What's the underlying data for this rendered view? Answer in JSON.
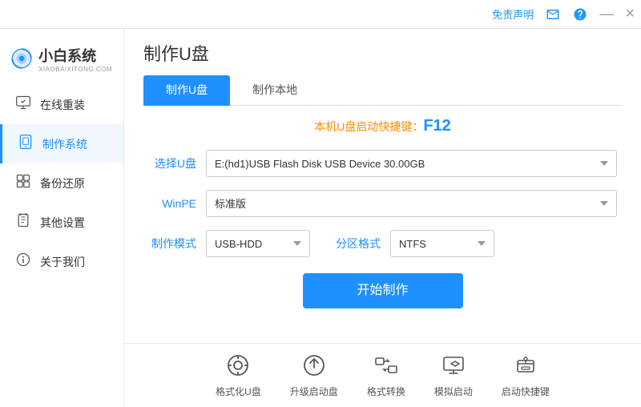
{
  "titlebar": {
    "free_declaration": "免责声明",
    "minimize": "—",
    "close": "×"
  },
  "logo": {
    "main_text": "小白系统",
    "sub_text": "XIAOBAIXITONG.COM"
  },
  "sidebar": {
    "items": [
      {
        "id": "online-reinstall",
        "label": "在线重装",
        "icon": "🖥"
      },
      {
        "id": "make-system",
        "label": "制作系统",
        "icon": "💾"
      },
      {
        "id": "backup-restore",
        "label": "备份还原",
        "icon": "🗂"
      },
      {
        "id": "other-settings",
        "label": "其他设置",
        "icon": "🔒"
      },
      {
        "id": "about-us",
        "label": "关于我们",
        "icon": "ℹ"
      }
    ],
    "active": "make-system"
  },
  "page": {
    "title": "制作U盘",
    "tabs": [
      {
        "id": "make-udisk",
        "label": "制作U盘",
        "active": true
      },
      {
        "id": "make-local",
        "label": "制作本地",
        "active": false
      }
    ]
  },
  "form": {
    "shortcut_prefix": "本机U盘启动快捷键：",
    "shortcut_key": "F12",
    "select_udisk_label": "选择U盘",
    "select_udisk_value": "E:(hd1)USB Flash Disk USB Device 30.00GB",
    "winpe_label": "WinPE",
    "winpe_value": "标准版",
    "make_mode_label": "制作模式",
    "make_mode_value": "USB-HDD",
    "partition_format_label": "分区格式",
    "partition_format_value": "NTFS",
    "start_button": "开始制作"
  },
  "toolbar": {
    "items": [
      {
        "id": "format-udisk",
        "label": "格式化U盘",
        "icon": "⊙"
      },
      {
        "id": "upgrade-boot",
        "label": "升级启动盘",
        "icon": "⊕"
      },
      {
        "id": "format-convert",
        "label": "格式转换",
        "icon": "⇄"
      },
      {
        "id": "simulate-boot",
        "label": "模拟启动",
        "icon": "⊞"
      },
      {
        "id": "boot-shortcut",
        "label": "启动快捷键",
        "icon": "🔑"
      }
    ]
  }
}
